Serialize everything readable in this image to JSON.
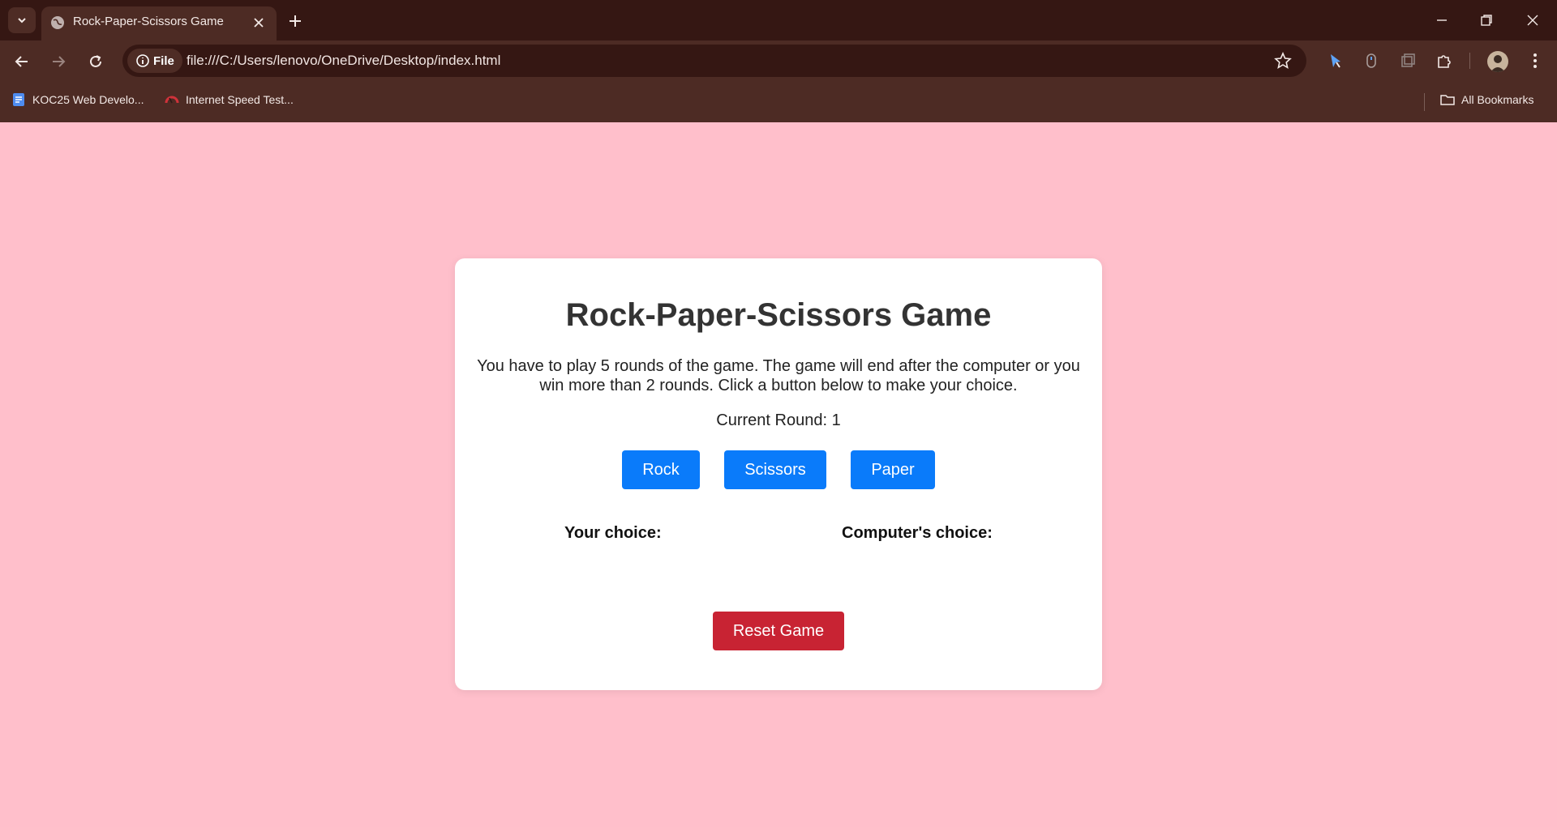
{
  "browser": {
    "tab_title": "Rock-Paper-Scissors Game",
    "url": "file:///C:/Users/lenovo/OneDrive/Desktop/index.html",
    "file_chip": "File",
    "bookmarks": [
      {
        "label": "KOC25 Web Develo...",
        "icon": "docs-icon"
      },
      {
        "label": "Internet Speed Test...",
        "icon": "speedometer-icon"
      }
    ],
    "all_bookmarks": "All Bookmarks"
  },
  "game": {
    "title": "Rock-Paper-Scissors Game",
    "instructions": "You have to play 5 rounds of the game. The game will end after the computer or you win more than 2 rounds. Click a button below to make your choice.",
    "current_round": "Current Round: 1",
    "buttons": {
      "rock": "Rock",
      "scissors": "Scissors",
      "paper": "Paper"
    },
    "your_choice_label": "Your choice:",
    "computer_choice_label": "Computer's choice:",
    "reset_label": "Reset Game"
  },
  "colors": {
    "page_background": "#ffbfcb",
    "choice_button": "#0a7bfa",
    "reset_button": "#c82333",
    "browser_frame": "#351713"
  }
}
